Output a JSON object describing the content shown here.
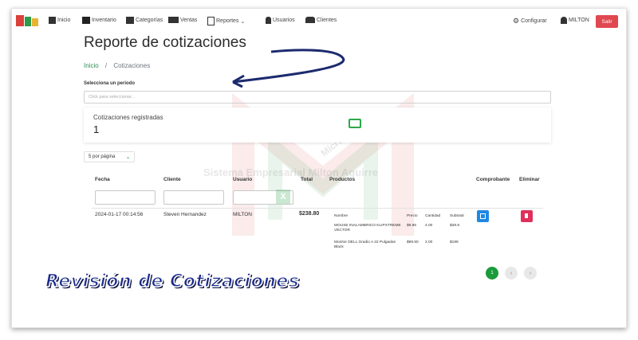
{
  "nav": {
    "items": [
      {
        "label": "Inicio",
        "icon": "home-icon"
      },
      {
        "label": "Inventario",
        "icon": "inventory-icon"
      },
      {
        "label": "Categorías",
        "icon": "categories-icon"
      },
      {
        "label": "Ventas",
        "icon": "sales-icon"
      },
      {
        "label": "Reportes",
        "icon": "report-icon"
      },
      {
        "label": "Usuarios",
        "icon": "user-icon"
      },
      {
        "label": "Clientes",
        "icon": "clients-icon"
      }
    ],
    "configurar": "Configurar",
    "user": "MILTON",
    "salir": "Salir"
  },
  "page": {
    "title": "Reporte de cotizaciones",
    "breadcrumb_home": "Inicio",
    "breadcrumb_sep": "/",
    "breadcrumb_current": "Cotizaciones",
    "period_label": "Selecciona un periodo",
    "period_placeholder": "Click para seleccionar..."
  },
  "summary": {
    "label": "Cotizaciones registradas",
    "count": "1"
  },
  "perpage": {
    "value": "5 por página",
    "chev": "⌄"
  },
  "table": {
    "headers": [
      "Fecha",
      "Cliente",
      "Usuario",
      "Total",
      "Productos",
      "Comprobante",
      "Eliminar"
    ],
    "row": {
      "fecha": "2024-01-17 00:14:56",
      "cliente": "Steven Hernandez",
      "usuario": "MILTON",
      "total": "$238.80",
      "product_headers": [
        "Nombre",
        "Precio",
        "Cantidad",
        "Subtotal"
      ],
      "products": [
        {
          "nombre": "MOUSE INALAMBRICO KLIPXTREME VECTOR",
          "precio": "$9.95",
          "cantidad": "4.00",
          "subtotal": "$39.8"
        },
        {
          "nombre": "Monitor DELL Gradio A 22 Pulgadas Black",
          "precio": "$99.50",
          "cantidad": "2.00",
          "subtotal": "$199"
        }
      ]
    }
  },
  "pagination": {
    "current": "1",
    "prev": "‹",
    "next": "›"
  },
  "banner": "Revisión de Cotizaciones",
  "watermark": {
    "line1": "MicroTeckVBA",
    "line2": "Sistema Empresarial Milton Aguirre"
  },
  "colors": {
    "accent": "#2ea84a",
    "salir": "#e0484f",
    "comprobante": "#1e88e5",
    "eliminar": "#e0305a"
  }
}
